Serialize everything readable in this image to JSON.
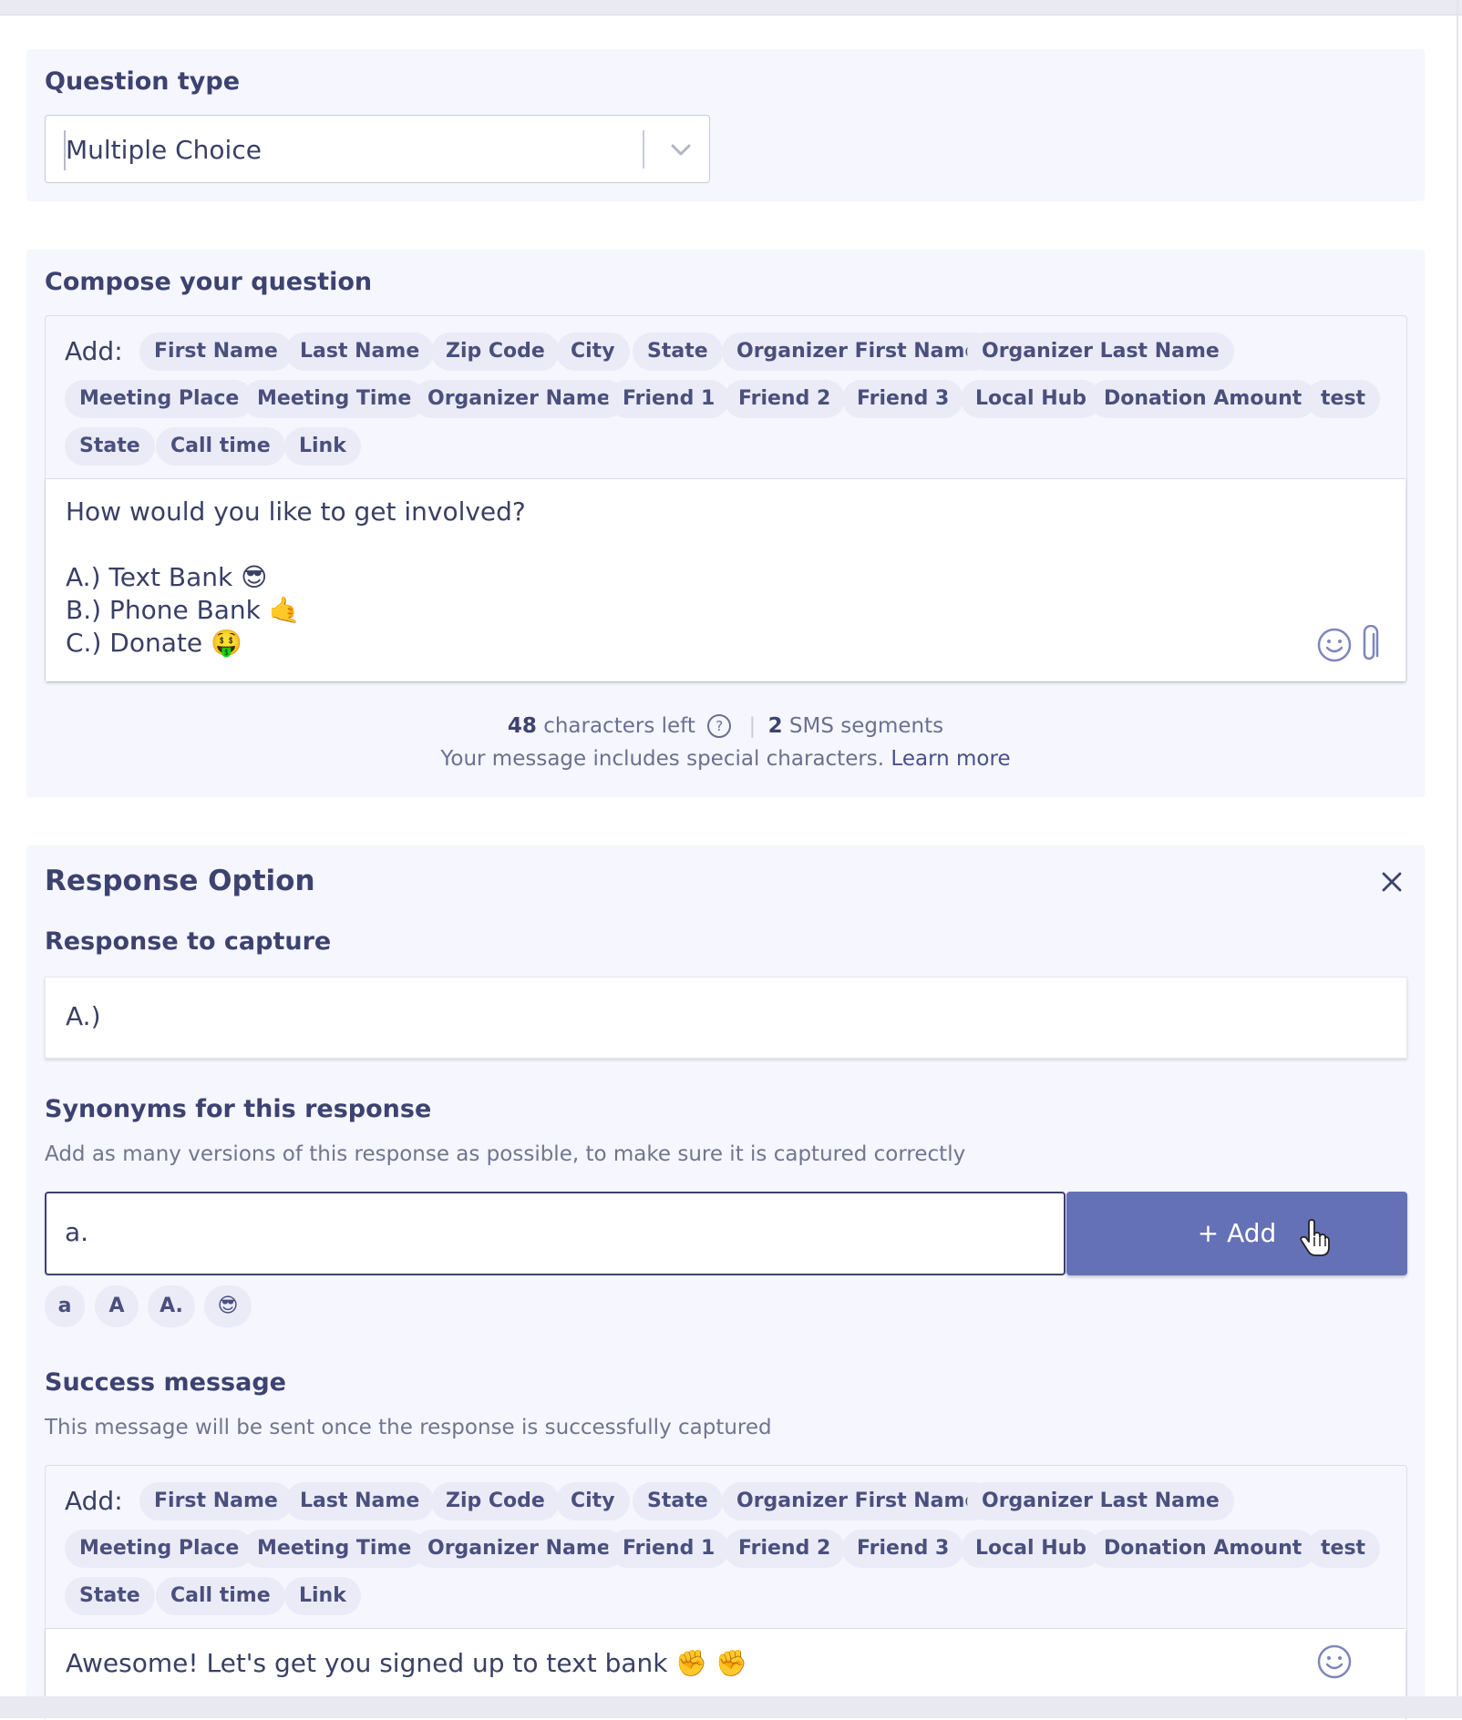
{
  "question_type": {
    "label": "Question type",
    "selected": "Multiple Choice"
  },
  "compose": {
    "label": "Compose your question",
    "add_label": "Add:",
    "tags": [
      "First Name",
      "Last Name",
      "Zip Code",
      "City",
      "State",
      "Organizer First Name",
      "Organizer Last Name",
      "Meeting Place",
      "Meeting Time",
      "Organizer Name",
      "Friend 1",
      "Friend 2",
      "Friend 3",
      "Local Hub",
      "Donation Amount",
      "test",
      "State",
      "Call time",
      "Link"
    ],
    "message_lines": [
      "How would you like to get involved?",
      "",
      "A.) Text Bank 😎",
      "B.) Phone Bank 🤙",
      "C.) Donate 🤑"
    ],
    "characters_left": "48",
    "characters_left_label": "characters left",
    "segments": "2",
    "segments_label": "SMS segments",
    "special_note": "Your message includes special characters.",
    "learn_more": "Learn more"
  },
  "response_option": {
    "title": "Response Option",
    "capture_label": "Response to capture",
    "capture_value": "A.)",
    "synonyms_label": "Synonyms for this response",
    "synonyms_helper": "Add as many versions of this response as possible, to make sure it is captured correctly",
    "synonym_input": "a.",
    "add_button": "+ Add",
    "synonyms": [
      "a",
      "A",
      "A.",
      "😎"
    ],
    "success_label": "Success message",
    "success_helper": "This message will be sent once the response is successfully captured",
    "success_message": "Awesome! Let's get you signed up to text bank ✊ ✊"
  },
  "colors": {
    "accent": "#6571b7",
    "panel": "#f5f6fe",
    "text": "#3d4270"
  }
}
